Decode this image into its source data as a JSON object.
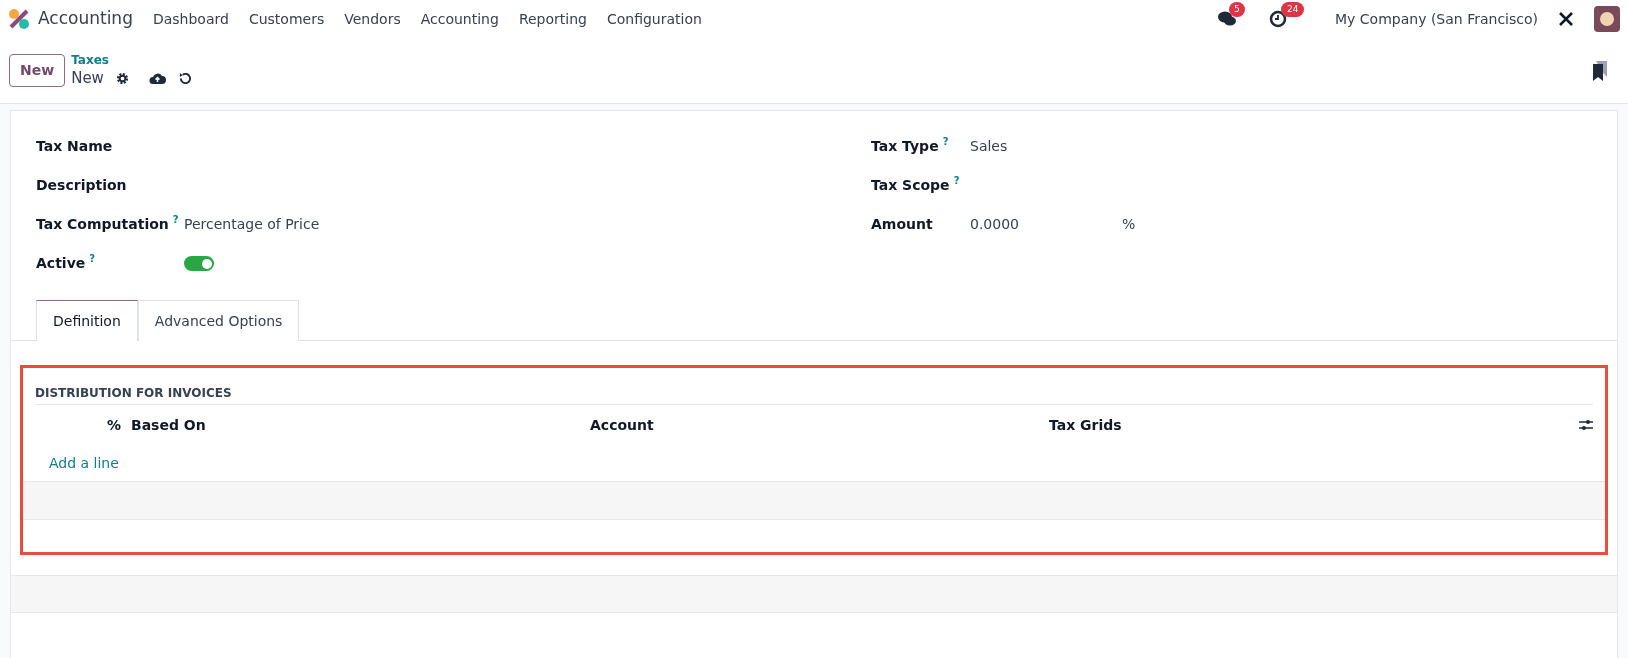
{
  "navbar": {
    "app_name": "Accounting",
    "menu": [
      "Dashboard",
      "Customers",
      "Vendors",
      "Accounting",
      "Reporting",
      "Configuration"
    ],
    "messages_badge": "5",
    "activities_badge": "24",
    "company": "My Company (San Francisco)"
  },
  "control_panel": {
    "new_button": "New",
    "breadcrumb": "Taxes",
    "record": "New"
  },
  "left_fields": [
    {
      "label": "Tax Name",
      "kind": "text"
    },
    {
      "label": "Description",
      "kind": "text"
    },
    {
      "label": "Tax Computation",
      "help": "?",
      "kind": "text",
      "value": "Percentage of Price"
    },
    {
      "label": "Active",
      "help": "?",
      "kind": "toggle",
      "on": true
    }
  ],
  "right_fields": [
    {
      "label": "Tax Type",
      "help": "?",
      "value": "Sales"
    },
    {
      "label": "Tax Scope",
      "help": "?"
    },
    {
      "label": "Amount",
      "value": "0.0000",
      "suffix": "%"
    }
  ],
  "tabs": [
    {
      "label": "Definition",
      "selected": true
    },
    {
      "label": "Advanced Options",
      "selected": false
    }
  ],
  "section": {
    "title": "DISTRIBUTION FOR INVOICES",
    "columns": [
      "%",
      "Based On",
      "Account",
      "Tax Grids"
    ],
    "add_line": "Add a line"
  }
}
